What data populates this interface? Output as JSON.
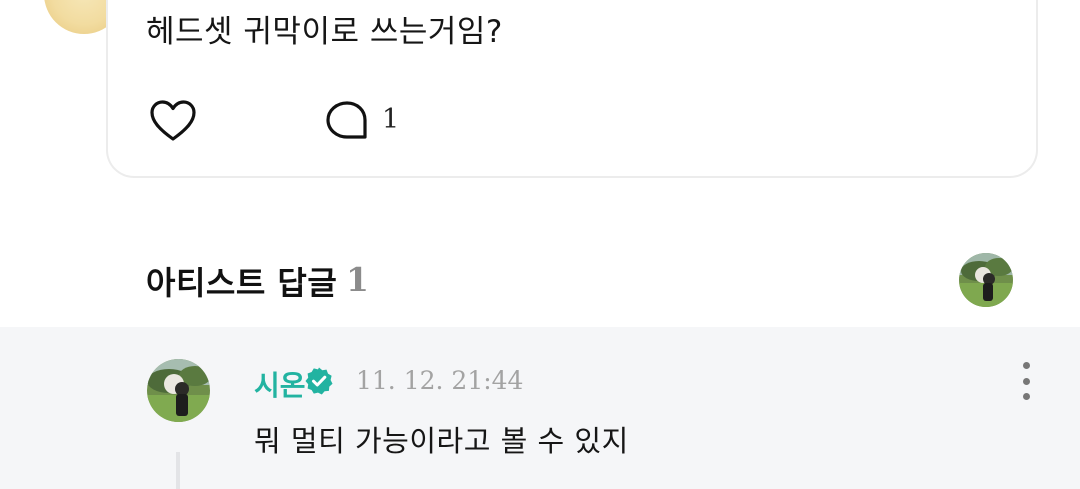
{
  "post": {
    "text": "헤드셋 귀막이로 쓰는거임?",
    "like_icon": "heart-outline-icon",
    "comment_icon": "speech-bubble-icon",
    "comment_count": "1"
  },
  "artist_replies": {
    "title": "아티스트 답글",
    "count": "1"
  },
  "reply": {
    "author": "시온",
    "verified_icon": "verified-badge-icon",
    "timestamp": "11. 12. 21:44",
    "text": "뭐 멀티 가능이라고 볼 수 있지",
    "more_icon": "more-vertical-icon"
  },
  "colors": {
    "accent": "#22b3a1",
    "reply_bg": "#f5f6f8",
    "muted": "#a3a3a3"
  }
}
